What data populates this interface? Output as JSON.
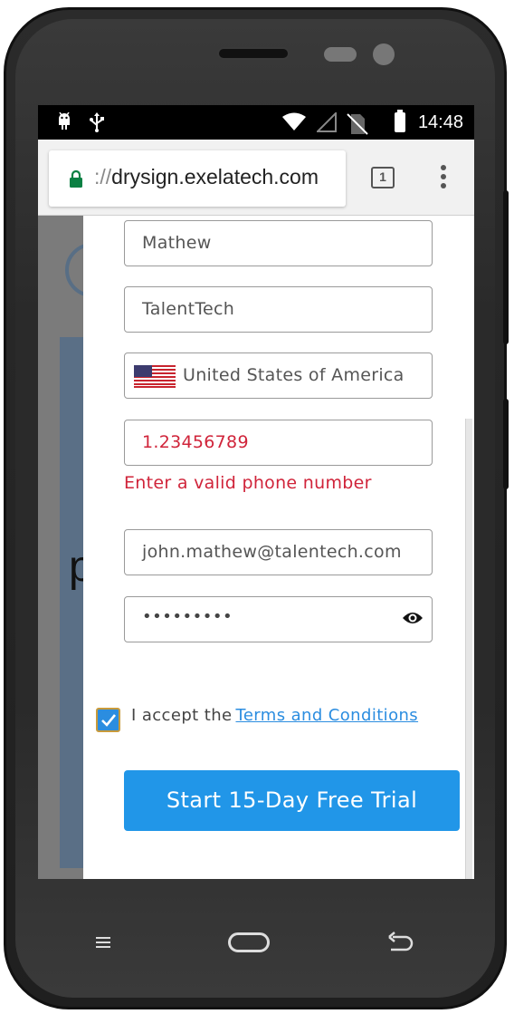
{
  "status_bar": {
    "time": "14:48",
    "icons": [
      "android-icon",
      "usb-icon",
      "wifi-icon",
      "signal-icon",
      "no-sim-icon",
      "battery-icon"
    ]
  },
  "browser": {
    "url_prefix": "://",
    "url_domain": "drysign.exelatech.com",
    "tab_count": "1"
  },
  "form": {
    "last_name": "Mathew",
    "company": "TalentTech",
    "country": "United States of America",
    "phone": "1.23456789",
    "phone_error": "Enter a valid phone number",
    "email": "john.mathew@talentech.com",
    "password_masked": "•••••••••",
    "terms_prefix": "I accept the",
    "terms_link": "Terms and Conditions",
    "terms_checked": true,
    "submit_label": "Start 15-Day Free Trial"
  },
  "page_behind": {
    "hero_letter": "p"
  },
  "colors": {
    "accent": "#2196e8",
    "error": "#d0243a",
    "link": "#2b8de0"
  }
}
